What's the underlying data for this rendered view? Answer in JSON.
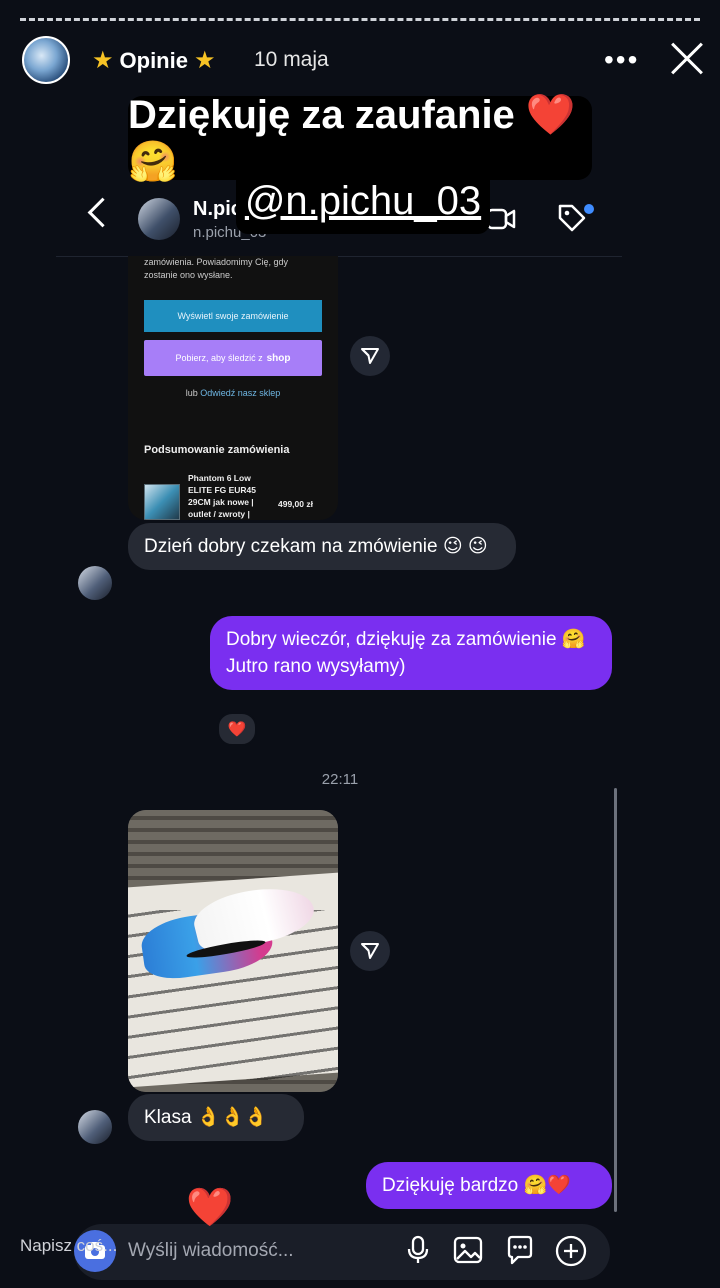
{
  "story": {
    "title": "Opinie",
    "date": "10 maja"
  },
  "stickers": {
    "thanks": "Dziękuję za zaufanie ❤️🤗",
    "mention": "@n.pichu_03"
  },
  "dm_header": {
    "name": "N.pic",
    "handle": "n.pichu_03"
  },
  "email": {
    "intro": "zamówienia. Powiadomimy Cię, gdy zostanie ono wysłane.",
    "view_order": "Wyświetl swoje zamówienie",
    "download": "Pobierz, aby śledzić z",
    "shop": "shop",
    "or_word": "lub",
    "visit": "Odwiedź nasz sklep",
    "summary": "Podsumowanie zamówienia",
    "product": "Phantom 6 Low ELITE FG EUR45 29CM jak nowe | outlet / zwroty |",
    "price": "499,00 zł"
  },
  "messages": {
    "m1": "Dzień dobry czekam na zmówienie 😉 😉",
    "m2_line1": "Dobry wieczór, dziękuję za zamówienie 🤗",
    "m2_line2": "Jutro rano wysyłamy)",
    "m2_reaction": "❤️",
    "time": "22:11",
    "m3": "Klasa 👌👌👌",
    "m4": "Dziękuję bardzo 🤗❤️"
  },
  "composer": {
    "placeholder": "Wyślij wiadomość...",
    "overlay": "Napisz coś..."
  },
  "floating_heart": "❤️",
  "colors": {
    "background": "#0b0e16",
    "outgoing_bubble": "#7a2ff0",
    "incoming_bubble": "#262a34",
    "camera_button": "#4a6fe0"
  }
}
